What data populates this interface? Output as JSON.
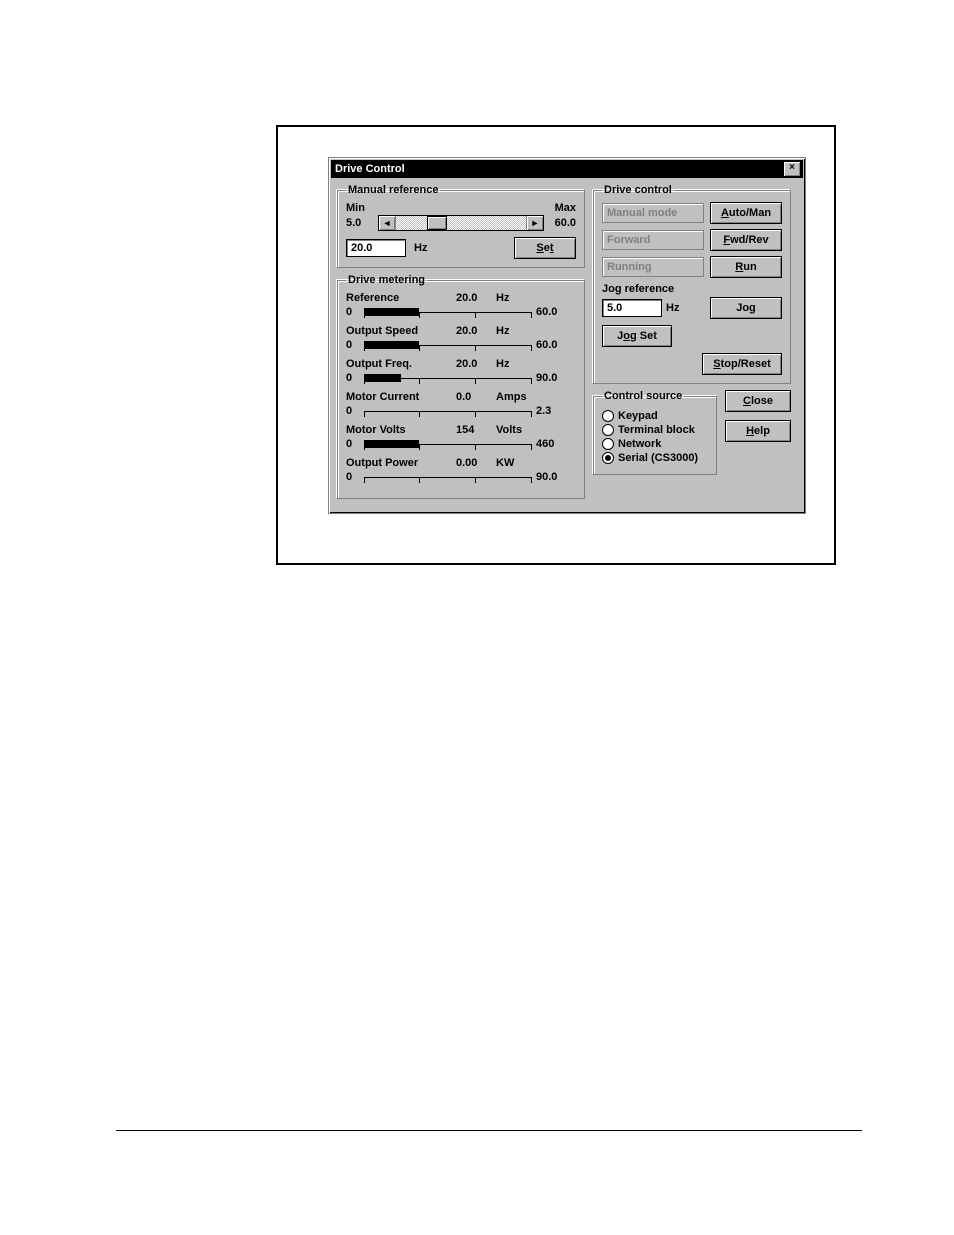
{
  "window": {
    "title": "Drive Control"
  },
  "manual_ref": {
    "legend": "Manual reference",
    "min_label": "Min",
    "max_label": "Max",
    "min_value": "5.0",
    "max_value": "60.0",
    "value": "20.0",
    "unit": "Hz",
    "set_btn": "Set"
  },
  "metering": {
    "legend": "Drive metering",
    "items": [
      {
        "name": "Reference",
        "value": "20.0",
        "unit": "Hz",
        "lo": "0",
        "hi": "60.0",
        "pct": 33
      },
      {
        "name": "Output Speed",
        "value": "20.0",
        "unit": "Hz",
        "lo": "0",
        "hi": "60.0",
        "pct": 33
      },
      {
        "name": "Output Freq.",
        "value": "20.0",
        "unit": "Hz",
        "lo": "0",
        "hi": "90.0",
        "pct": 22
      },
      {
        "name": "Motor Current",
        "value": "0.0",
        "unit": "Amps",
        "lo": "0",
        "hi": "2.3",
        "pct": 0
      },
      {
        "name": "Motor Volts",
        "value": "154",
        "unit": "Volts",
        "lo": "0",
        "hi": "460",
        "pct": 33
      },
      {
        "name": "Output Power",
        "value": "0.00",
        "unit": "KW",
        "lo": "0",
        "hi": "90.0",
        "pct": 0
      }
    ]
  },
  "drive_control": {
    "legend": "Drive control",
    "mode_status": "Manual mode",
    "auto_man_btn": "Auto/Man",
    "dir_status": "Forward",
    "fwd_rev_btn": "Fwd/Rev",
    "run_status": "Running",
    "run_btn": "Run",
    "jog_label": "Jog reference",
    "jog_value": "5.0",
    "jog_unit": "Hz",
    "jog_btn": "Jog",
    "jog_set_btn": "Jog Set",
    "stop_btn": "Stop/Reset"
  },
  "control_source": {
    "legend": "Control source",
    "options": [
      {
        "label": "Keypad",
        "selected": false
      },
      {
        "label": "Terminal block",
        "selected": false
      },
      {
        "label": "Network",
        "selected": false
      },
      {
        "label": "Serial (CS3000)",
        "selected": true
      }
    ],
    "close_btn": "Close",
    "help_btn": "Help"
  }
}
